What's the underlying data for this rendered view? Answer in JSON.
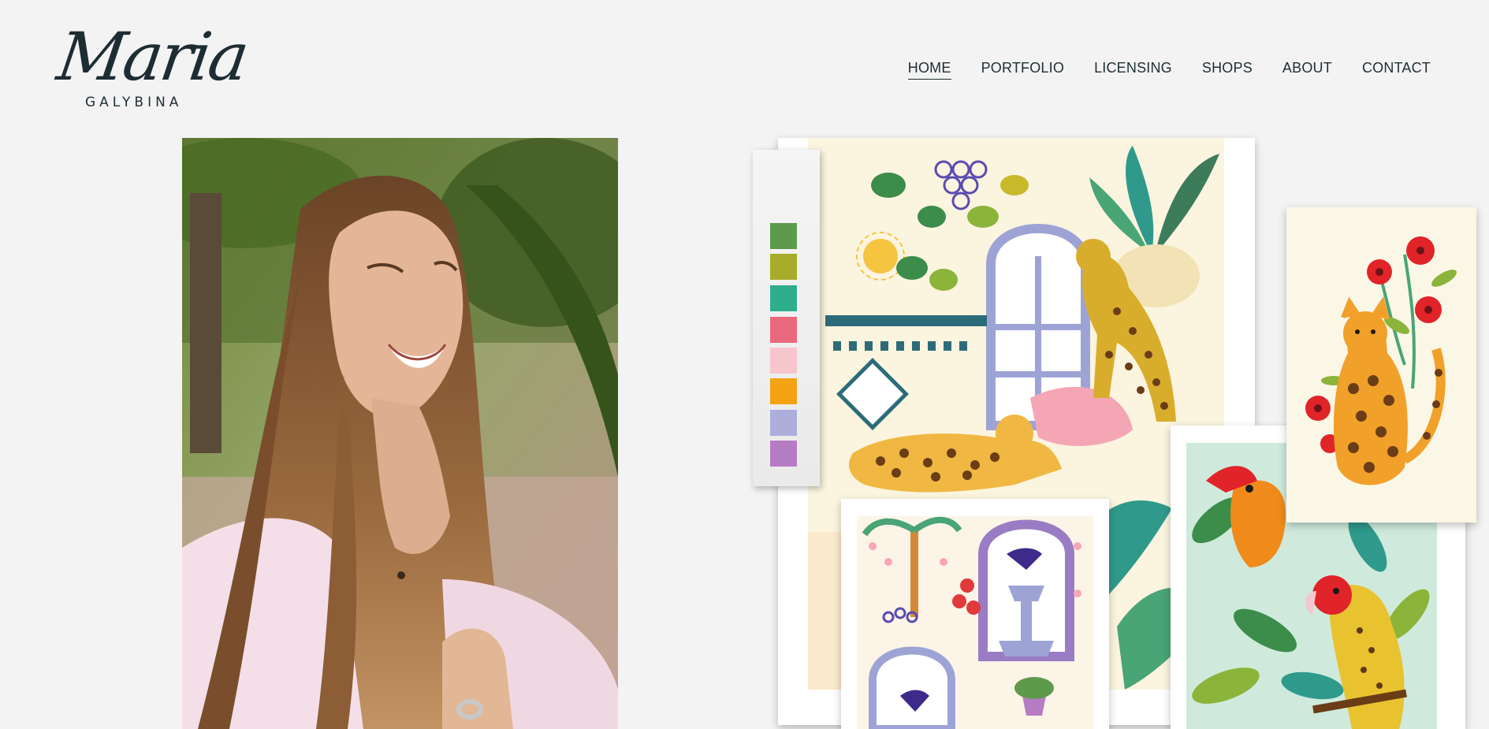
{
  "logo": {
    "script": "Maria",
    "subtitle": "GALYBINA"
  },
  "nav": {
    "items": [
      {
        "label": "HOME",
        "active": true
      },
      {
        "label": "PORTFOLIO",
        "active": false
      },
      {
        "label": "LICENSING",
        "active": false
      },
      {
        "label": "SHOPS",
        "active": false
      },
      {
        "label": "ABOUT",
        "active": false
      },
      {
        "label": "CONTACT",
        "active": false
      }
    ]
  },
  "collage": {
    "palette": [
      "#5e9a4c",
      "#a8ac2a",
      "#2fae8e",
      "#ea6a7c",
      "#f7c6cd",
      "#f3a212",
      "#aeaedc",
      "#b57cc4"
    ]
  },
  "colors": {
    "background": "#f3f3f3",
    "text": "#1e2d33"
  }
}
